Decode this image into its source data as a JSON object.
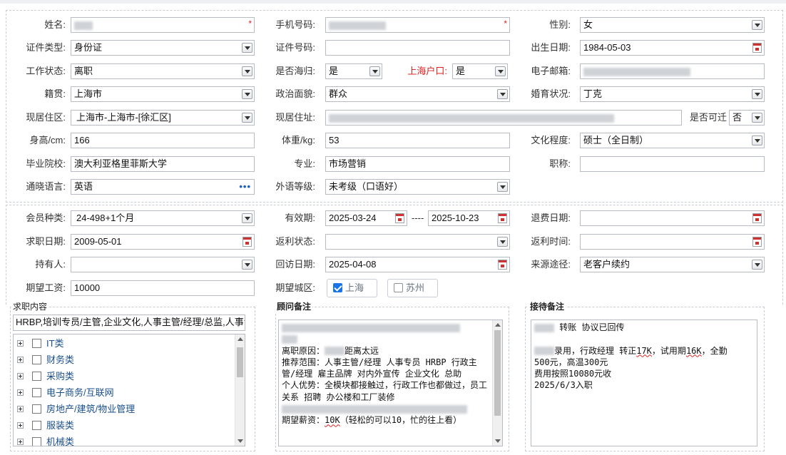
{
  "sections": {
    "basic": {
      "name_label": "姓名:",
      "phone_label": "手机号码:",
      "gender_label": "性别:",
      "gender_value": "女",
      "id_type_label": "证件类型:",
      "id_type_value": "身份证",
      "id_number_label": "证件号码:",
      "birth_label": "出生日期:",
      "birth_value": "1984-05-03",
      "work_status_label": "工作状态:",
      "work_status_value": "离职",
      "returnee_label": "是否海归:",
      "returnee_value": "是",
      "hukou_label": "上海户口:",
      "hukou_value": "是",
      "email_label": "电子邮箱:",
      "native_label": "籍贯:",
      "native_value": "上海市",
      "political_label": "政治面貌:",
      "political_value": "群众",
      "marital_label": "婚育状况:",
      "marital_value": "丁克",
      "residence_label": "现居住区:",
      "residence_value": "上海市-上海市-[徐汇区]",
      "address_label": "现居住址:",
      "relocate_label": "是否可迁",
      "relocate_value": "否",
      "height_label": "身高/cm:",
      "height_value": "166",
      "weight_label": "体重/kg:",
      "weight_value": "53",
      "education_label": "文化程度:",
      "education_value": "硕士（全日制）",
      "school_label": "毕业院校:",
      "school_value": "澳大利亚格里菲斯大学",
      "major_label": "专业:",
      "major_value": "市场营销",
      "title_label": "职称:",
      "language_label": "通晓语言:",
      "language_value": "英语",
      "more_glyph": "•••",
      "foreign_level_label": "外语等级:",
      "foreign_level_value": "未考级（口语好）"
    },
    "membership": {
      "member_type_label": "会员种类:",
      "member_type_value": "24-498+1个月",
      "validity_label": "有效期:",
      "validity_start": "2025-03-24",
      "validity_sep": "----",
      "validity_end": "2025-10-23",
      "refund_date_label": "退费日期:",
      "job_date_label": "求职日期:",
      "job_date_value": "2009-05-01",
      "rebate_status_label": "返利状态:",
      "rebate_time_label": "返利时间:",
      "holder_label": "持有人:",
      "visit_date_label": "回访日期:",
      "visit_date_value": "2025-04-08",
      "source_label": "来源途径:",
      "source_value": "老客户续约",
      "salary_label": "期望工资:",
      "salary_value": "10000",
      "city_label": "期望城区:",
      "cities": [
        {
          "label": "上海",
          "checked": true
        },
        {
          "label": "苏州",
          "checked": false
        }
      ]
    }
  },
  "panels": {
    "job": {
      "title": "求职内容",
      "summary": "HRBP,培训专员/主管,企业文化,人事主管/经理/总监,人事专",
      "tree": [
        "IT类",
        "财务类",
        "采购类",
        "电子商务/互联网",
        "房地产/建筑/物业管理",
        "服装类",
        "机械类"
      ]
    },
    "advisor": {
      "title": "顾问备注",
      "reason_label": "离职原因：",
      "reason_tail": "距离太远",
      "scope": "推荐范围：人事主管/经理 人事专员 HRBP 行政主管/经理 雇主品牌 对内外宣传 企业文化 总助",
      "advantage": "个人优势：全模块都接触过，行政工作也都做过，员工关系 招聘 办公楼和工厂装修",
      "expect_label": "期望薪资：",
      "expect_value": "10K",
      "expect_tail": "（轻松的可以10，忙的往上看）"
    },
    "reception": {
      "title": "接待备注",
      "line1_tail": "转账 协议已回传",
      "line2_mid": "录用，行政经理 转正",
      "line2_a": "17K",
      "line2_b": "，试用期",
      "line2_c": "16K",
      "line2_d": "，全勤",
      "line3": "500元，高温300元",
      "line4": "费用按照10080元收",
      "line5": "2025/6/3入职"
    }
  },
  "colors": {
    "accent": "#1a73e8",
    "required": "#e02020",
    "border": "#b7bcc4"
  }
}
